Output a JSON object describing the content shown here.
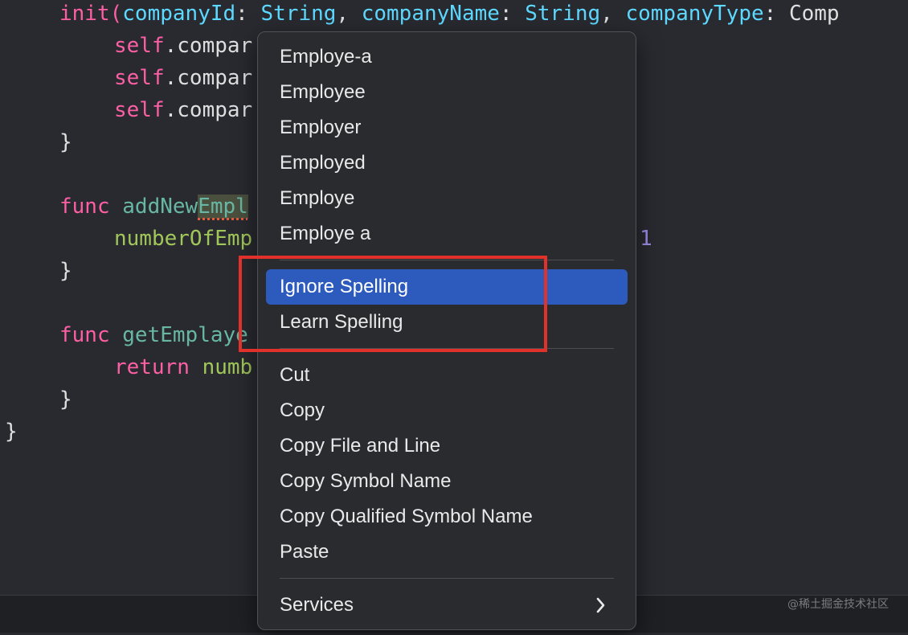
{
  "code": {
    "l1_init": "init(",
    "l1_p1": "companyId",
    "l1_c1": ": ",
    "l1_t1": "String",
    "l1_s1": ", ",
    "l1_p2": "companyName",
    "l1_c2": ": ",
    "l1_t2": "String",
    "l1_s2": ", ",
    "l1_p3": "companyType",
    "l1_c3": ": ",
    "l1_t3": "Comp",
    "self_kw": "self",
    "self_rest": ".compar",
    "brace_close": "}",
    "func_kw": "func",
    "add_name": "addNew",
    "add_misspelled": "Empl",
    "numberOf": "numberOfEmp",
    "num_one": "1",
    "get_name": "getEmplaye",
    "return_kw": "return",
    "return_rest": "numb"
  },
  "menu": {
    "suggestions": [
      "Employe-a",
      "Employee",
      "Employer",
      "Employed",
      "Employe",
      "Employe a"
    ],
    "spelling": [
      {
        "label": "Ignore Spelling",
        "selected": true
      },
      {
        "label": "Learn Spelling",
        "selected": false
      }
    ],
    "edit": [
      "Cut",
      "Copy",
      "Copy File and Line",
      "Copy Symbol Name",
      "Copy Qualified Symbol Name",
      "Paste"
    ],
    "services": "Services",
    "chevron_icon": "chevron-right-icon"
  },
  "watermark": "@稀土掘金技术社区",
  "colors": {
    "selection": "#2c5bbd",
    "annotation": "#e0322b",
    "editor_bg": "#292a30"
  }
}
